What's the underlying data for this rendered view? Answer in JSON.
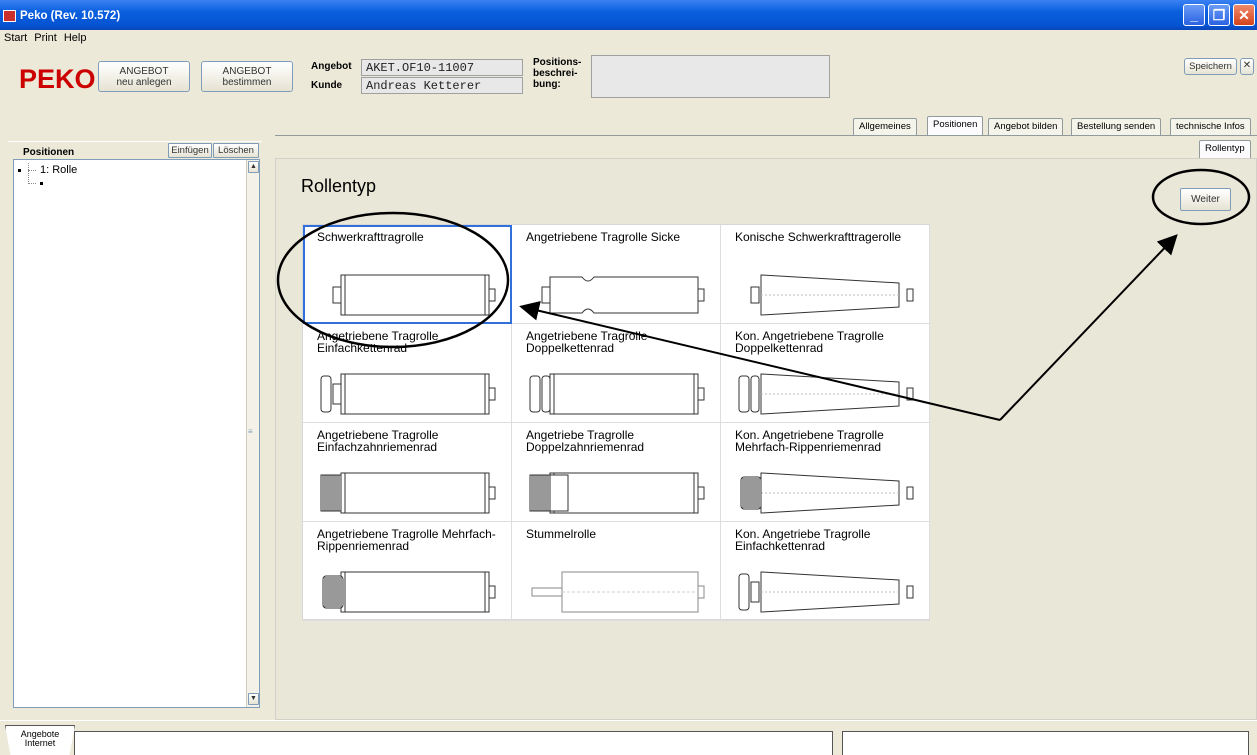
{
  "window": {
    "title": "Peko (Rev. 10.572)"
  },
  "menu": [
    "Start",
    "Print",
    "Help"
  ],
  "header": {
    "logo": "PEKO",
    "btn_new_l1": "ANGEBOT",
    "btn_new_l2": "neu anlegen",
    "btn_det_l1": "ANGEBOT",
    "btn_det_l2": "bestimmen",
    "angebot_label": "Angebot",
    "angebot_value": "AKET.OF10-11007",
    "kunde_label": "Kunde",
    "kunde_value": "Andreas Ketterer",
    "pos_l1": "Positions-",
    "pos_l2": "beschrei-",
    "pos_l3": "bung:",
    "pos_value": "",
    "save": "Speichern",
    "close": "✕"
  },
  "tabs": [
    "Allgemeines",
    "Positionen",
    "Angebot bilden",
    "Bestellung senden",
    "technische Infos"
  ],
  "subtab": "Rollentyp",
  "left": {
    "title": "Positionen",
    "insert": "Einfügen",
    "delete": "Löschen",
    "tree_item": "1: Rolle"
  },
  "content": {
    "heading": "Rollentyp",
    "next": "Weiter"
  },
  "rollers": [
    {
      "name": "Schwerkrafttragrolle",
      "icon": "plain-roller-icon"
    },
    {
      "name": "Angetriebene Tragrolle Sicke",
      "icon": "grooved-roller-icon"
    },
    {
      "name": "Konische Schwerkrafttragerolle",
      "icon": "conical-roller-icon"
    },
    {
      "name": "Angetriebene Tragrolle Einfachkettenrad",
      "icon": "single-sprocket-roller-icon"
    },
    {
      "name": "Angetriebene Tragrolle Doppelkettenrad",
      "icon": "double-sprocket-roller-icon"
    },
    {
      "name": "Kon. Angetriebene Tragrolle Doppelkettenrad",
      "icon": "conical-double-sprocket-roller-icon"
    },
    {
      "name": "Angetriebene Tragrolle Einfachzahnriemenrad",
      "icon": "single-timing-belt-roller-icon"
    },
    {
      "name": "Angetriebe Tragrolle Doppelzahnriemenrad",
      "icon": "double-timing-belt-roller-icon"
    },
    {
      "name": "Kon. Angetriebene Tragrolle Mehrfach-Rippenriemenrad",
      "icon": "conical-poly-v-roller-icon"
    },
    {
      "name": "Angetriebene Tragrolle Mehrfach-Rippenriemenrad",
      "icon": "poly-v-roller-icon"
    },
    {
      "name": "Stummelrolle",
      "icon": "stub-roller-icon"
    },
    {
      "name": "Kon. Angetriebe Tragrolle Einfachkettenrad",
      "icon": "conical-single-sprocket-roller-icon"
    }
  ],
  "bottom": {
    "tab_l1": "Angebote",
    "tab_l2": "Internet"
  },
  "colors": {
    "title_bar": "#0a5fde",
    "logo": "#cc0000",
    "selection": "#3170d8"
  }
}
